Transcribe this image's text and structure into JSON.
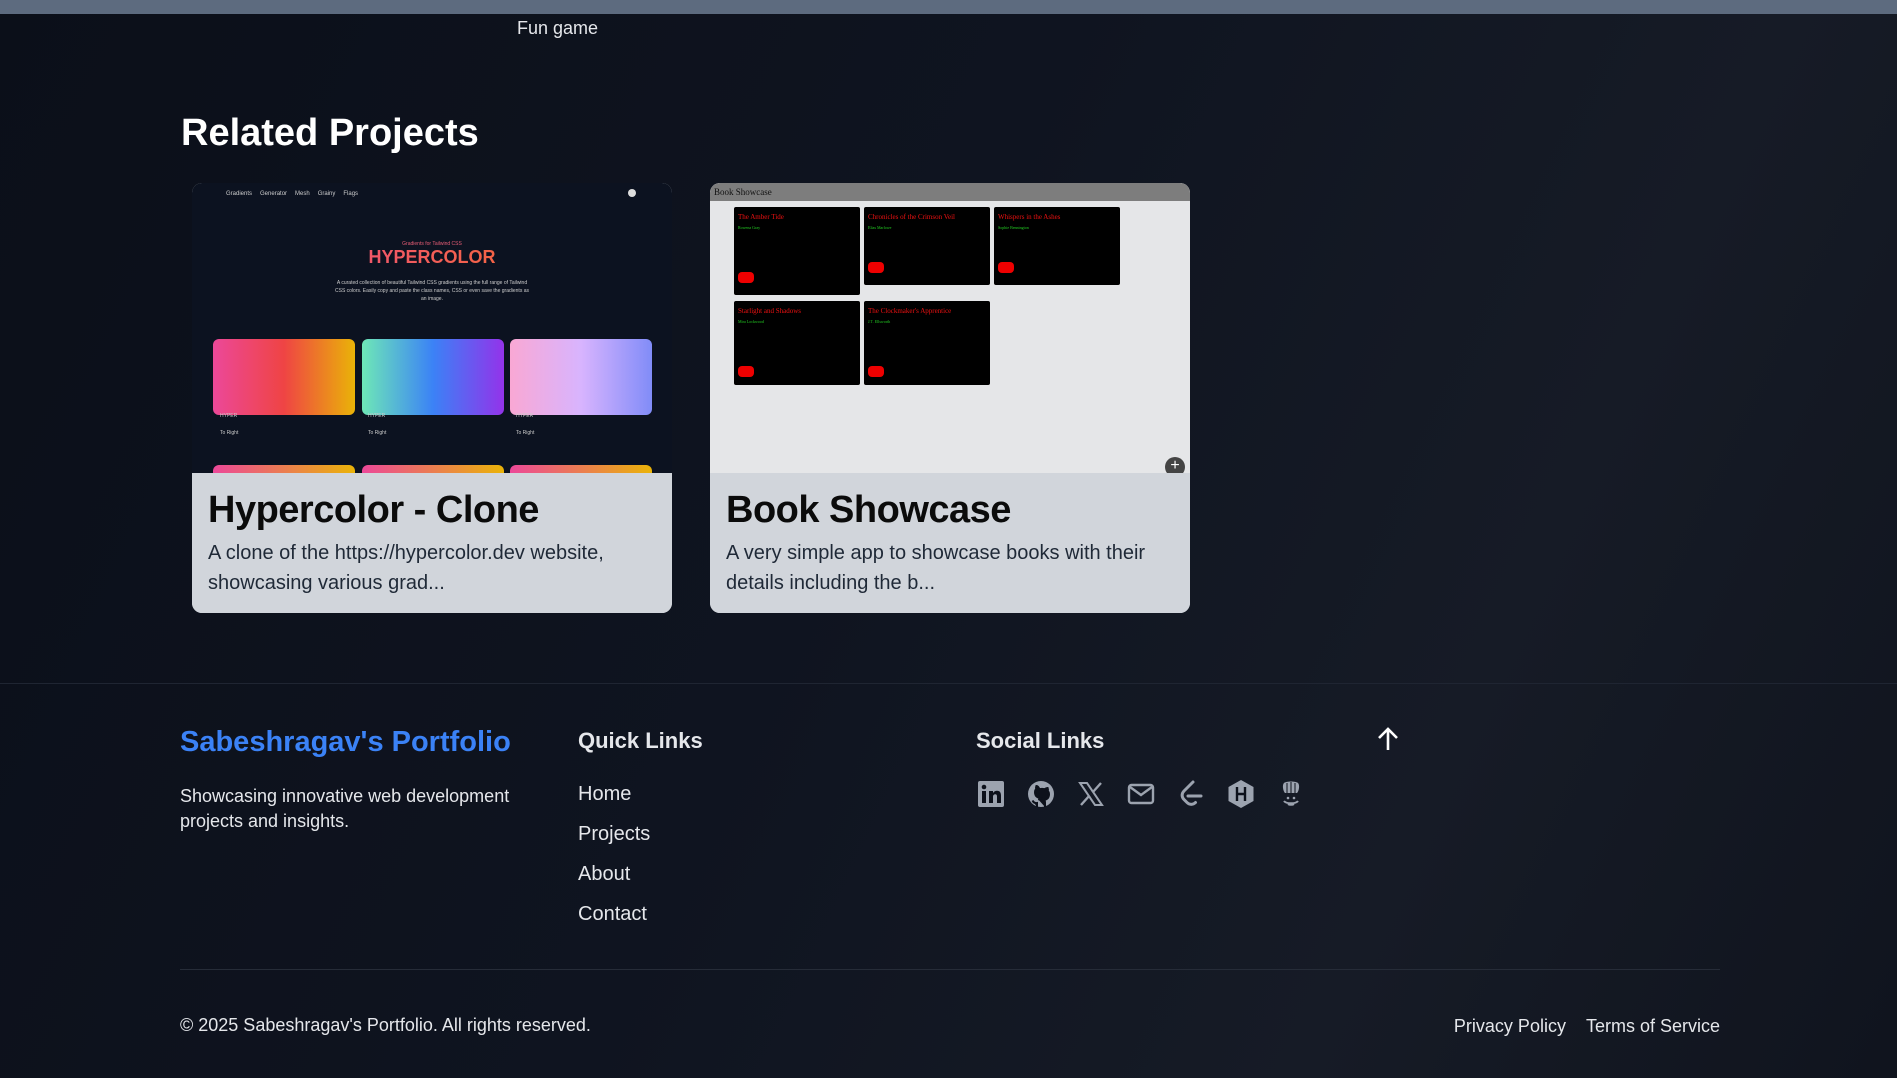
{
  "top_label": "Fun game",
  "related": {
    "heading": "Related Projects",
    "projects": [
      {
        "title": "Hypercolor - Clone",
        "description": "A clone of the https://hypercolor.dev website, showcasing various grad...",
        "thumb": {
          "nav": [
            "Gradients",
            "Generator",
            "Mesh",
            "Grainy",
            "Flags"
          ],
          "subtitle": "Gradients for Tailwind CSS",
          "logo": "HYPERCOLOR",
          "intro": "A curated collection of beautiful Tailwind CSS gradients using the full range of Tailwind CSS colors. Easily copy and paste the class names, CSS or even save the gradients as an image.",
          "swatch_label": "HYPER",
          "direction": "To Right"
        }
      },
      {
        "title": "Book Showcase",
        "description": "A very simple app to showcase books with their details including the b...",
        "thumb": {
          "header": "Book Showcase",
          "books": [
            {
              "title": "The Amber Tide",
              "author": "Rowena Gray"
            },
            {
              "title": "Chronicles of the Crimson Veil",
              "author": "Elias Marlowe"
            },
            {
              "title": "Whispers in the Ashes",
              "author": "Sophie Bennington"
            },
            {
              "title": "Starlight and Shadows",
              "author": "Mira Lockwood"
            },
            {
              "title": "The Clockmaker's Apprentice",
              "author": "J.T. Ellsworth"
            }
          ],
          "add": "+"
        }
      }
    ]
  },
  "footer": {
    "brand": "Sabeshragav's Portfolio",
    "tagline": "Showcasing innovative web development projects and insights.",
    "quick_links_heading": "Quick Links",
    "quick_links": [
      "Home",
      "Projects",
      "About",
      "Contact"
    ],
    "social_heading": "Social Links",
    "social_icons": [
      "linkedin-icon",
      "github-icon",
      "x-icon",
      "mail-icon",
      "leetcode-icon",
      "hackerrank-icon",
      "codechef-icon"
    ],
    "icon_color": "#9ca3af",
    "copyright": "© 2025 Sabeshragav's Portfolio. All rights reserved.",
    "legal": [
      "Privacy Policy",
      "Terms of Service"
    ]
  }
}
